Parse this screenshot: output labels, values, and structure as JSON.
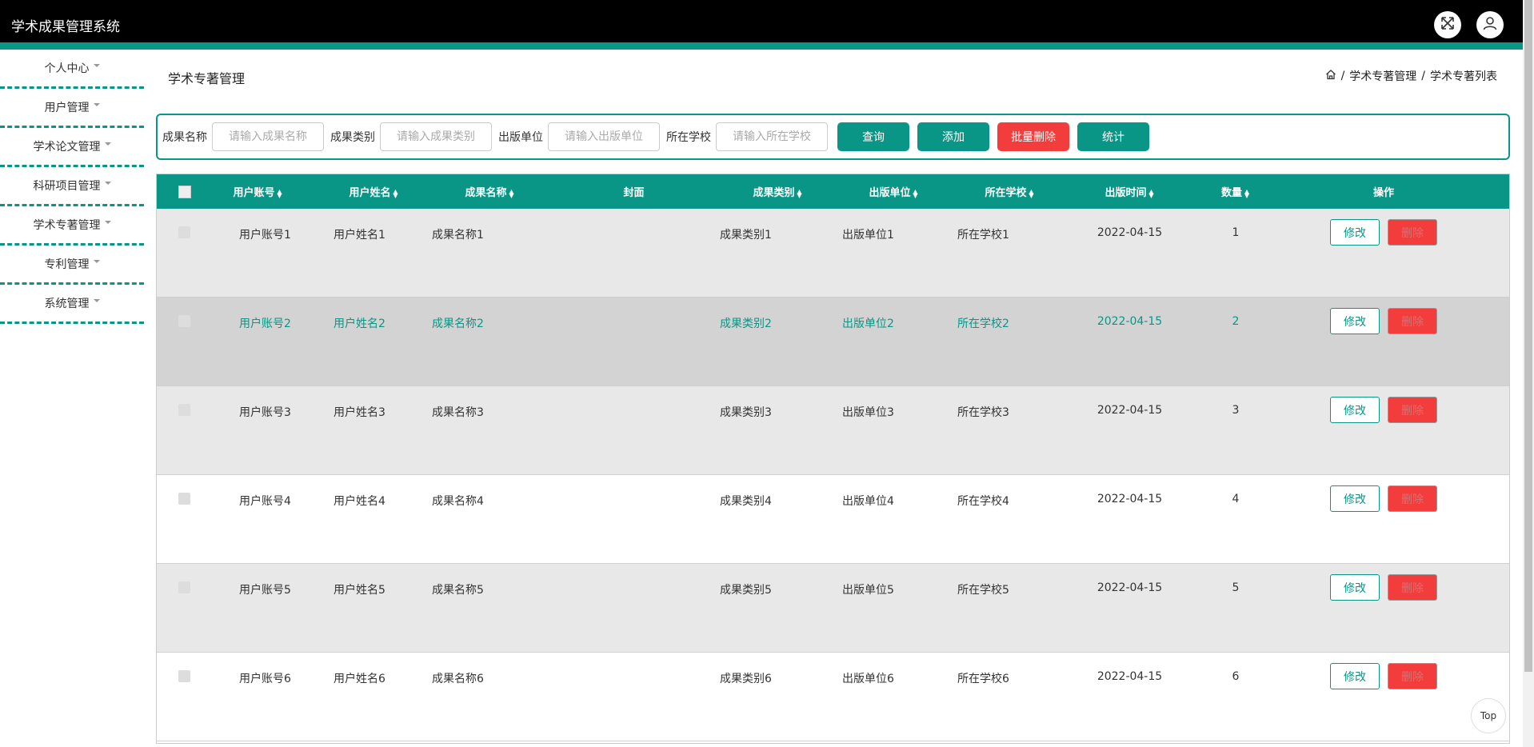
{
  "app": {
    "title": "学术成果管理系统"
  },
  "sidebar": {
    "items": [
      {
        "label": "个人中心"
      },
      {
        "label": "用户管理"
      },
      {
        "label": "学术论文管理"
      },
      {
        "label": "科研项目管理"
      },
      {
        "label": "学术专著管理"
      },
      {
        "label": "专利管理"
      },
      {
        "label": "系统管理"
      }
    ]
  },
  "page": {
    "title": "学术专著管理",
    "breadcrumb": [
      "学术专著管理",
      "学术专著列表"
    ],
    "breadcrumb_sep": "/"
  },
  "search": {
    "fields": [
      {
        "label": "成果名称",
        "placeholder": "请输入成果名称"
      },
      {
        "label": "成果类别",
        "placeholder": "请输入成果类别"
      },
      {
        "label": "出版单位",
        "placeholder": "请输入出版单位"
      },
      {
        "label": "所在学校",
        "placeholder": "请输入所在学校"
      }
    ],
    "buttons": {
      "query": "查询",
      "add": "添加",
      "batch_delete": "批量删除",
      "stats": "统计"
    }
  },
  "table": {
    "headers": {
      "account": "用户账号",
      "name": "用户姓名",
      "title": "成果名称",
      "cover": "封面",
      "category": "成果类别",
      "publisher": "出版单位",
      "school": "所在学校",
      "date": "出版时间",
      "count": "数量",
      "ops": "操作"
    },
    "rows": [
      {
        "account": "用户账号1",
        "name": "用户姓名1",
        "title": "成果名称1",
        "category": "成果类别1",
        "publisher": "出版单位1",
        "school": "所在学校1",
        "date": "2022-04-15",
        "count": "1"
      },
      {
        "account": "用户账号2",
        "name": "用户姓名2",
        "title": "成果名称2",
        "category": "成果类别2",
        "publisher": "出版单位2",
        "school": "所在学校2",
        "date": "2022-04-15",
        "count": "2"
      },
      {
        "account": "用户账号3",
        "name": "用户姓名3",
        "title": "成果名称3",
        "category": "成果类别3",
        "publisher": "出版单位3",
        "school": "所在学校3",
        "date": "2022-04-15",
        "count": "3"
      },
      {
        "account": "用户账号4",
        "name": "用户姓名4",
        "title": "成果名称4",
        "category": "成果类别4",
        "publisher": "出版单位4",
        "school": "所在学校4",
        "date": "2022-04-15",
        "count": "4"
      },
      {
        "account": "用户账号5",
        "name": "用户姓名5",
        "title": "成果名称5",
        "category": "成果类别5",
        "publisher": "出版单位5",
        "school": "所在学校5",
        "date": "2022-04-15",
        "count": "5"
      },
      {
        "account": "用户账号6",
        "name": "用户姓名6",
        "title": "成果名称6",
        "category": "成果类别6",
        "publisher": "出版单位6",
        "school": "所在学校6",
        "date": "2022-04-15",
        "count": "6"
      }
    ],
    "row_buttons": {
      "edit": "修改",
      "delete": "删除"
    }
  },
  "back_to_top": "Top",
  "colors": {
    "primary": "#0a9686",
    "danger": "#f33d3d",
    "topbar": "#000000"
  }
}
